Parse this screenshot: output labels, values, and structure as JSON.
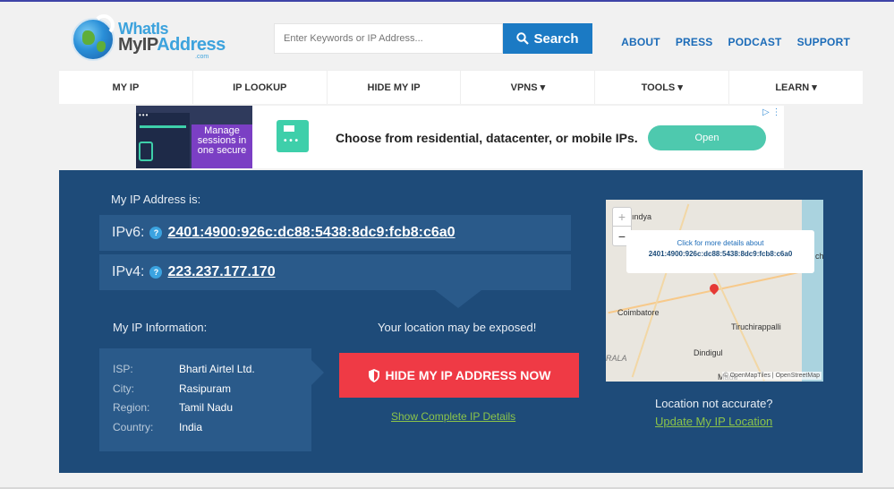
{
  "logo": {
    "line1": "WhatIs",
    "line2a": "MyIP",
    "line2b": "Address",
    "com": ".com"
  },
  "search": {
    "placeholder": "Enter Keywords or IP Address...",
    "button_label": "Search"
  },
  "top_links": [
    "ABOUT",
    "PRESS",
    "PODCAST",
    "SUPPORT"
  ],
  "nav": [
    "MY IP",
    "IP LOOKUP",
    "HIDE MY IP",
    "VPNS ▾",
    "TOOLS ▾",
    "LEARN ▾"
  ],
  "ad": {
    "image_text": "Manage sessions in one secure",
    "headline": "Choose from residential, datacenter, or mobile IPs.",
    "button_label": "Open",
    "choices": "▷ ⋮"
  },
  "main": {
    "ip_label": "My IP Address is:",
    "ipv6_label": "IPv6:",
    "ipv6_value": "2401:4900:926c:dc88:5438:8dc9:fcb8:c6a0",
    "ipv4_label": "IPv4:",
    "ipv4_value": "223.237.177.170",
    "info_label": "My IP Information:",
    "info": [
      {
        "key": "ISP:",
        "value": "Bharti Airtel Ltd."
      },
      {
        "key": "City:",
        "value": "Rasipuram"
      },
      {
        "key": "Region:",
        "value": "Tamil Nadu"
      },
      {
        "key": "Country:",
        "value": "India"
      }
    ],
    "exposed_text": "Your location may be exposed!",
    "hide_button_label": "HIDE MY IP ADDRESS NOW",
    "show_details": "Show Complete IP Details",
    "map": {
      "popup_line1": "Click for more details about",
      "popup_line2": "2401:4900:926c:dc88:5438:8dc9:fcb8:c6a0",
      "labels": [
        "ındya",
        "Coimbatore",
        "Tiruchirappalli",
        "Dindigul",
        "RALA",
        "Madu",
        "ch"
      ],
      "attribution": "© OpenMapTiles | OpenStreetMap",
      "zoom_in": "+",
      "zoom_out": "−"
    },
    "loc_not_accurate": "Location not accurate?",
    "update_location": "Update My IP Location"
  },
  "colors": {
    "brand_blue": "#1b7ac4",
    "main_bg": "#1e4b79",
    "hide_red": "#ef3a45",
    "link_green": "#8bc34a"
  }
}
